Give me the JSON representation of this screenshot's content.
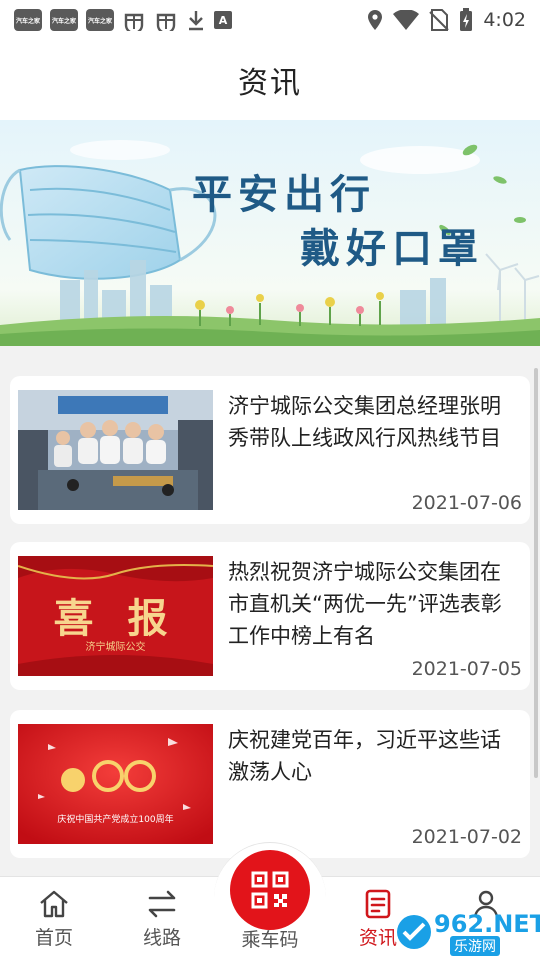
{
  "status_bar": {
    "badges": [
      "汽车之家",
      "汽车之家",
      "汽车之家"
    ],
    "glyph_a": "A",
    "time": "4:02"
  },
  "header": {
    "title": "资讯"
  },
  "banner": {
    "line1": "平安出行",
    "line2": "戴好口罩"
  },
  "news": [
    {
      "title": "济宁城际公交集团总经理张明秀带队上线政风行风热线节目",
      "date": "2021-07-06"
    },
    {
      "title": "热烈祝贺济宁城际公交集团在市直机关“两优一先”评选表彰工作中榜上有名",
      "date": "2021-07-05",
      "thumb_big": "喜 报",
      "thumb_small": "济宁城际公交"
    },
    {
      "title": "庆祝建党百年，习近平这些话激荡人心",
      "date": "2021-07-02",
      "thumb_big": "100",
      "thumb_small": "庆祝中国共产党成立100周年"
    }
  ],
  "nav": {
    "home": "首页",
    "routes": "线路",
    "qr": "乘车码",
    "news": "资讯",
    "mine": "我的"
  },
  "watermark": {
    "main": "962.NET",
    "sub": "乐游网"
  },
  "colors": {
    "accent": "#d0161b",
    "qr_red": "#e2141a",
    "banner_text": "#1f5a86"
  }
}
